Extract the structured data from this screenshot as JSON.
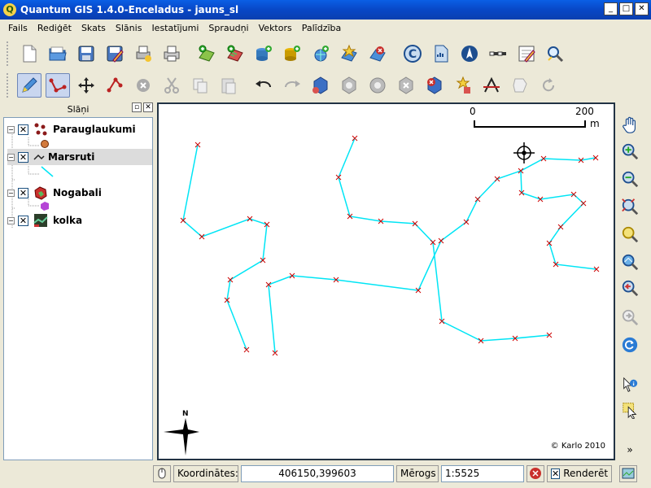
{
  "window": {
    "title": "Quantum GIS 1.4.0-Enceladus - jauns_sl",
    "app_icon": "Q"
  },
  "menu": [
    "Fails",
    "Rediģēt",
    "Skats",
    "Slānis",
    "Iestatījumi",
    "Spraudņi",
    "Vektors",
    "Palīdzība"
  ],
  "layers_panel": {
    "title": "Slāņi",
    "layers": [
      {
        "name": "Parauglaukumi",
        "checked": true,
        "icon": "points-layer-icon"
      },
      {
        "name": "Marsruti",
        "checked": true,
        "icon": "line-layer-icon",
        "selected": true
      },
      {
        "name": "Nogabali",
        "checked": true,
        "icon": "polygon-layer-icon"
      },
      {
        "name": "kolka",
        "checked": true,
        "icon": "raster-layer-icon"
      }
    ]
  },
  "map": {
    "scalebar": {
      "start": "0",
      "end": "200",
      "unit": "m"
    },
    "north_arrow_label": "N",
    "copyright": "© Karlo 2010",
    "line_color": "#00e5f5",
    "vertex_color": "#cc0000"
  },
  "status": {
    "coords_label": "Koordinātes:",
    "coords_value": "406150,399603",
    "scale_label": "Mērogs",
    "scale_value": "1:5525",
    "render_label": "Renderēt",
    "render_checked": true
  }
}
